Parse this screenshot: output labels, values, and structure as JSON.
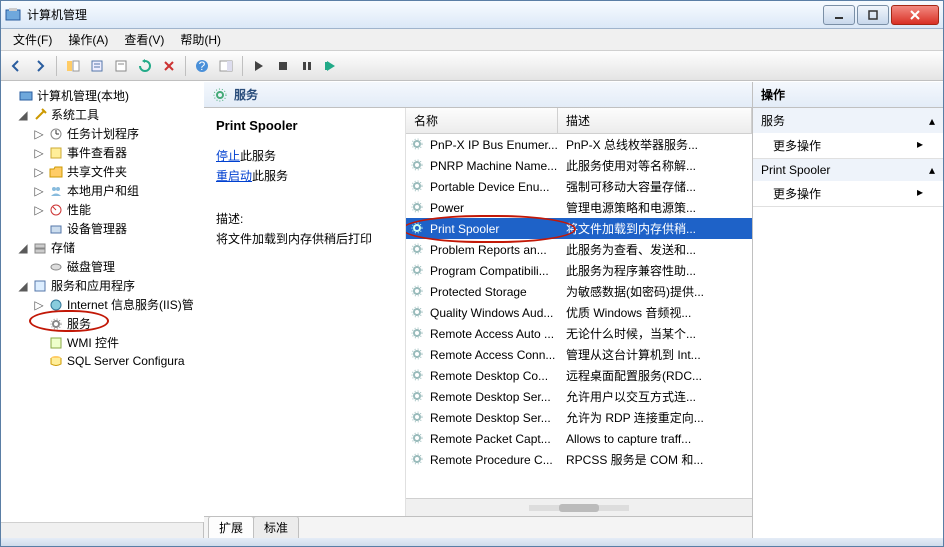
{
  "window": {
    "title": "计算机管理"
  },
  "menu": {
    "file": "文件(F)",
    "action": "操作(A)",
    "view": "查看(V)",
    "help": "帮助(H)"
  },
  "tree": {
    "root": "计算机管理(本地)",
    "system_tools": "系统工具",
    "task_scheduler": "任务计划程序",
    "event_viewer": "事件查看器",
    "shared_folders": "共享文件夹",
    "local_users": "本地用户和组",
    "performance": "性能",
    "device_manager": "设备管理器",
    "storage": "存储",
    "disk_mgmt": "磁盘管理",
    "services_apps": "服务和应用程序",
    "iis": "Internet 信息服务(IIS)管",
    "services": "服务",
    "wmi": "WMI 控件",
    "sql": "SQL Server Configura"
  },
  "center": {
    "header": "服务",
    "selected_name": "Print Spooler",
    "stop_label": "停止",
    "stop_suffix": "此服务",
    "restart_label": "重启动",
    "restart_suffix": "此服务",
    "desc_label": "描述:",
    "desc_text": "将文件加载到内存供稍后打印",
    "col_name": "名称",
    "col_desc": "描述",
    "tab_ext": "扩展",
    "tab_std": "标准"
  },
  "services": [
    {
      "name": "PnP-X IP Bus Enumer...",
      "desc": "PnP-X 总线枚举器服务..."
    },
    {
      "name": "PNRP Machine Name...",
      "desc": "此服务使用对等名称解..."
    },
    {
      "name": "Portable Device Enu...",
      "desc": "强制可移动大容量存储..."
    },
    {
      "name": "Power",
      "desc": "管理电源策略和电源策..."
    },
    {
      "name": "Print Spooler",
      "desc": "将文件加载到内存供稍...",
      "selected": true
    },
    {
      "name": "Problem Reports an...",
      "desc": "此服务为查看、发送和..."
    },
    {
      "name": "Program Compatibili...",
      "desc": "此服务为程序兼容性助..."
    },
    {
      "name": "Protected Storage",
      "desc": "为敏感数据(如密码)提供..."
    },
    {
      "name": "Quality Windows Aud...",
      "desc": "优质 Windows 音频视..."
    },
    {
      "name": "Remote Access Auto ...",
      "desc": "无论什么时候，当某个..."
    },
    {
      "name": "Remote Access Conn...",
      "desc": "管理从这台计算机到 Int..."
    },
    {
      "name": "Remote Desktop Co...",
      "desc": "远程桌面配置服务(RDC..."
    },
    {
      "name": "Remote Desktop Ser...",
      "desc": "允许用户以交互方式连..."
    },
    {
      "name": "Remote Desktop Ser...",
      "desc": "允许为 RDP 连接重定向..."
    },
    {
      "name": "Remote Packet Capt...",
      "desc": "Allows to capture traff..."
    },
    {
      "name": "Remote Procedure C...",
      "desc": "RPCSS 服务是 COM 和..."
    }
  ],
  "actions": {
    "header": "操作",
    "group1": "服务",
    "more": "更多操作",
    "group2": "Print Spooler"
  }
}
